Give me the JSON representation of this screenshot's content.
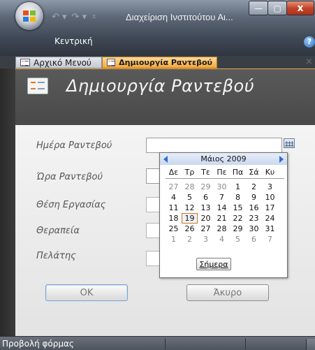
{
  "window": {
    "title": "Διαχείριση Ινστιτούτου Αι...",
    "buttons": {
      "minimize": "—",
      "maximize": "▢",
      "close": "x"
    }
  },
  "ribbon": {
    "active_tab": "Κεντρική",
    "help": "?"
  },
  "doc_tabs": [
    {
      "label": "Αρχικό Μενού"
    },
    {
      "label": "Δημιουργία Ραντεβού"
    }
  ],
  "doc_tabs_close": "×",
  "form": {
    "title": "Δημιουργία Ραντεβού",
    "fields": [
      {
        "label": "Ημέρα Ραντεβού",
        "value": ""
      },
      {
        "label": "Ώρα Ραντεβού",
        "value": ""
      },
      {
        "label": "Θέση Εργασίας",
        "value": ""
      },
      {
        "label": "Θεραπεία",
        "value": ""
      },
      {
        "label": "Πελάτης",
        "value": ""
      }
    ],
    "ok_label": "ΟΚ",
    "cancel_label": "Άκυρο"
  },
  "datepicker": {
    "month_label": "Μάιος 2009",
    "weekdays": [
      "Δε",
      "Τρ",
      "Τε",
      "Πε",
      "Πα",
      "Σά",
      "Κυ"
    ],
    "weeks": [
      [
        "27",
        "28",
        "29",
        "30",
        "1",
        "2",
        "3"
      ],
      [
        "4",
        "5",
        "6",
        "7",
        "8",
        "9",
        "10"
      ],
      [
        "11",
        "12",
        "13",
        "14",
        "15",
        "16",
        "17"
      ],
      [
        "18",
        "19",
        "20",
        "21",
        "22",
        "23",
        "24"
      ],
      [
        "25",
        "26",
        "27",
        "28",
        "29",
        "30",
        "31"
      ],
      [
        "1",
        "2",
        "3",
        "4",
        "5",
        "6",
        "7"
      ]
    ],
    "today": "19",
    "today_button": "Σήμερα"
  },
  "status": {
    "text": "Προβολή φόρμας"
  },
  "colors": {
    "accent": "#f3a73b",
    "today_border": "#d0751c",
    "nav_arrow": "#2f6bd8"
  }
}
